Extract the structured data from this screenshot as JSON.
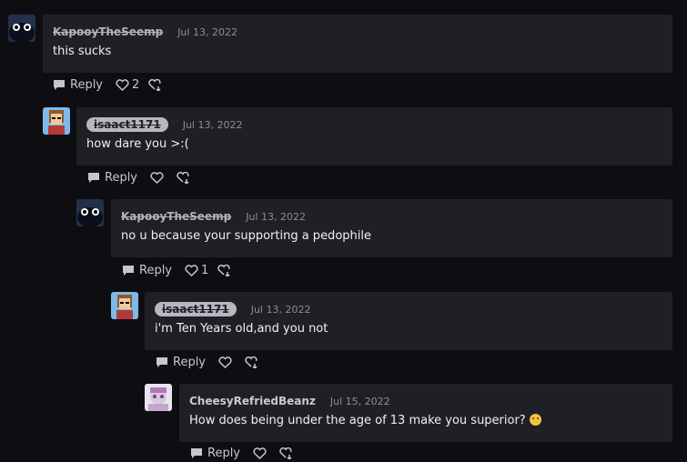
{
  "comments": [
    {
      "user": "KapooyTheSeemp",
      "date": "Jul 13, 2022",
      "text": "this sucks",
      "likes": "2",
      "reply_label": "Reply"
    },
    {
      "user": "isaact1171",
      "date": "Jul 13, 2022",
      "text": "how dare you >:(",
      "likes": "",
      "reply_label": "Reply"
    },
    {
      "user": "KapooyTheSeemp",
      "date": "Jul 13, 2022",
      "text": "no u because your supporting a pedophile",
      "likes": "1",
      "reply_label": "Reply"
    },
    {
      "user": "isaact1171",
      "date": "Jul 13, 2022",
      "text": "i'm Ten Years old,and you not",
      "likes": "",
      "reply_label": "Reply"
    },
    {
      "user": "CheesyRefriedBeanz",
      "date": "Jul 15, 2022",
      "text": "How does being under the age of 13 make you superior?",
      "likes": "",
      "reply_label": "Reply",
      "emoji": "confused-face-emoji"
    }
  ],
  "icons": {
    "reply": "speech-bubble-icon",
    "like": "heart-icon",
    "dislike": "heart-down-icon"
  },
  "colors": {
    "background": "#0e0e12",
    "bubble": "#1f2026",
    "pill": "#b6b7bf"
  }
}
